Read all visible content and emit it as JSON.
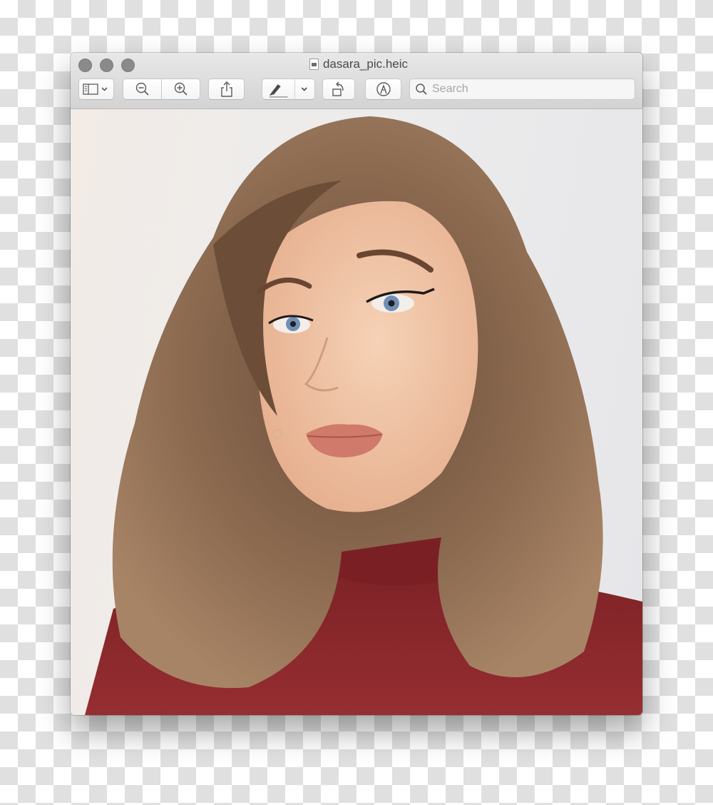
{
  "window": {
    "title": "dasara_pic.heic",
    "file_icon": "image-file-icon",
    "traffic_lights": [
      "close",
      "minimize",
      "zoom"
    ]
  },
  "toolbar": {
    "sidebar_toggle": {
      "icon": "sidebar-icon",
      "has_dropdown": true
    },
    "zoom_out": {
      "icon": "zoom-out-icon"
    },
    "zoom_in": {
      "icon": "zoom-in-icon"
    },
    "share": {
      "icon": "share-icon"
    },
    "markup_pen": {
      "icon": "highlighter-pen-icon",
      "has_dropdown": true
    },
    "rotate": {
      "icon": "rotate-left-icon"
    },
    "markup_toolbar": {
      "icon": "markup-circle-icon"
    },
    "search": {
      "placeholder": "Search",
      "value": ""
    }
  },
  "image": {
    "description": "Selfie of a woman with wavy light-brown hair wearing a dark red turtleneck against a light grey wall",
    "colors": {
      "background": "#ececec",
      "hair": "#8b6a50",
      "hair_dark": "#5e4433",
      "skin": "#efc2a4",
      "sweater": "#8e2a2d",
      "lips": "#cf7a6a",
      "eyes": "#6f8fb5"
    }
  }
}
